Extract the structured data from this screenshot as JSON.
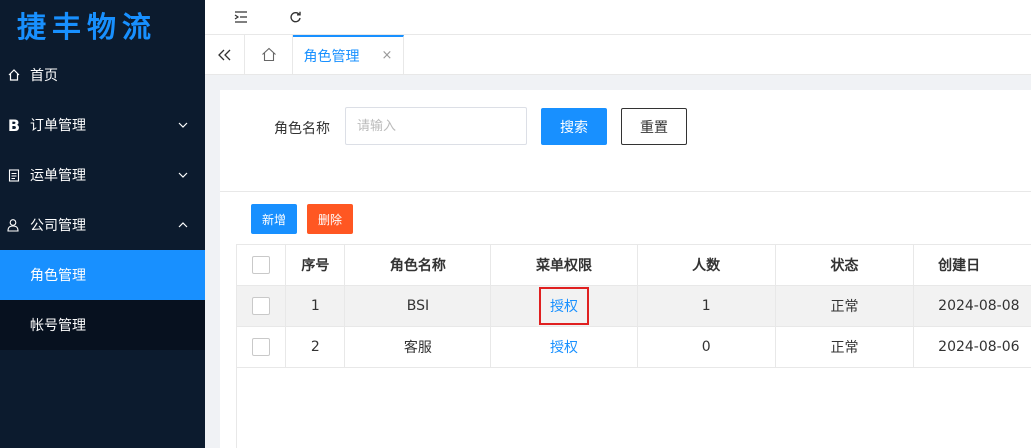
{
  "app": {
    "logo": "捷丰物流"
  },
  "sidebar": {
    "items": [
      {
        "label": "首页",
        "icon": "home-icon"
      },
      {
        "label": "订单管理",
        "icon": "bold-b-icon"
      },
      {
        "label": "运单管理",
        "icon": "document-icon"
      },
      {
        "label": "公司管理",
        "icon": "user-icon",
        "expanded": true,
        "children": [
          {
            "label": "角色管理",
            "active": true
          },
          {
            "label": "帐号管理"
          }
        ]
      }
    ]
  },
  "topbar": {
    "icons": [
      "menu-fold-icon",
      "refresh-icon"
    ]
  },
  "tabs": {
    "items": [
      {
        "label": "角色管理",
        "close": "×",
        "active": true
      }
    ]
  },
  "search": {
    "label": "角色名称",
    "placeholder": "请输入",
    "value": "",
    "search_btn": "搜索",
    "reset_btn": "重置"
  },
  "actions": {
    "add": "新增",
    "delete": "删除"
  },
  "table": {
    "columns": [
      "序号",
      "角色名称",
      "菜单权限",
      "人数",
      "状态",
      "创建日"
    ],
    "rows": [
      {
        "index": "1",
        "name": "BSI",
        "perm": "授权",
        "count": "1",
        "status": "正常",
        "created": "2024-08-08"
      },
      {
        "index": "2",
        "name": "客服",
        "perm": "授权",
        "count": "0",
        "status": "正常",
        "created": "2024-08-06"
      }
    ]
  },
  "colors": {
    "primary": "#1890ff",
    "danger": "#ff5722",
    "sidebar": "#0c1b2e",
    "highlight": "#e02020"
  }
}
